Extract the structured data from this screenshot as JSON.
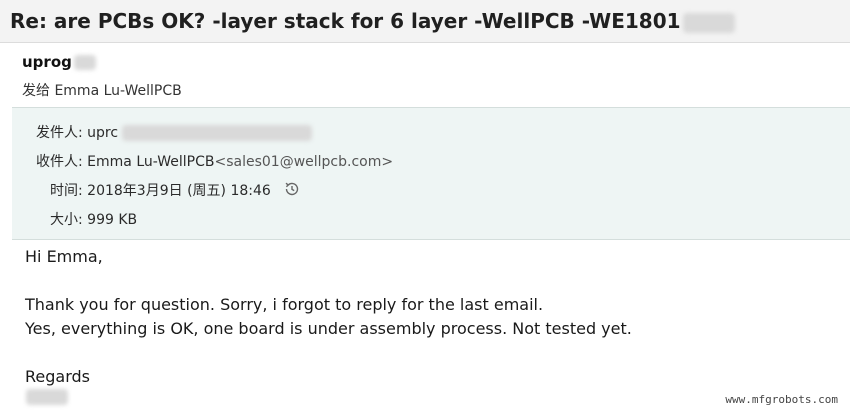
{
  "message": {
    "subject": "Re: are PCBs OK? -layer stack for 6 layer -WellPCB -WE1801",
    "sender_display": "uprog",
    "sent_to_prefix": "发给",
    "sent_to_name": "Emma Lu-WellPCB"
  },
  "meta": {
    "from_label": "发件人:",
    "from_value": "uprc",
    "to_label": "收件人:",
    "to_name": "Emma Lu-WellPCB",
    "to_email": "<sales01@wellpcb.com>",
    "time_label": "时间:",
    "time_value": "2018年3月9日 (周五) 18:46",
    "size_label": "大小:",
    "size_value": "999 KB",
    "history_icon": "history-clock-icon"
  },
  "body": {
    "greeting": "Hi Emma,",
    "line1": "Thank you for question. Sorry, i forgot to reply for the last email.",
    "line2": "Yes, everything is OK, one board is under assembly process. Not tested yet.",
    "closing": "Regards"
  },
  "watermark": "www.mfgrobots.com"
}
